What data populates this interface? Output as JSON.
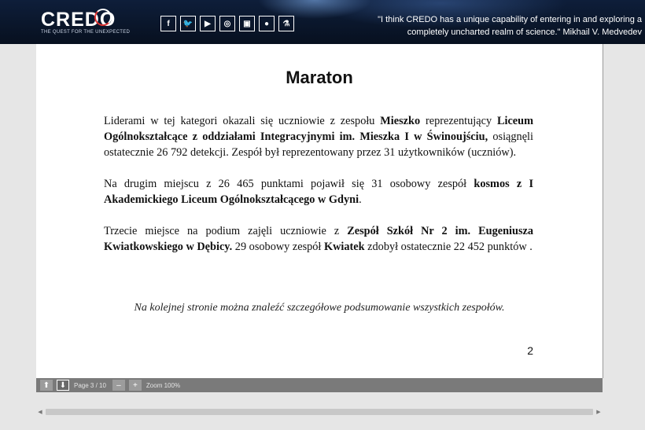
{
  "header": {
    "logo_text": "CREDO",
    "logo_tagline": "THE QUEST FOR THE UNEXPECTED",
    "quote_line1": "\"I think CREDO has a unique capability of entering in and exploring a",
    "quote_line2": "completely uncharted realm of science.\" Mikhail V. Medvedev",
    "socials": [
      {
        "icon": "facebook-icon",
        "glyph": "f"
      },
      {
        "icon": "twitter-icon",
        "glyph": "🐦"
      },
      {
        "icon": "youtube-icon",
        "glyph": "▶"
      },
      {
        "icon": "instagram-icon",
        "glyph": "◎"
      },
      {
        "icon": "camera-icon",
        "glyph": "▣"
      },
      {
        "icon": "github-icon",
        "glyph": "●"
      },
      {
        "icon": "flask-icon",
        "glyph": "⚗"
      }
    ]
  },
  "document": {
    "title": "Maraton",
    "p1": {
      "t1": "Liderami w tej kategori okazali się uczniowie z zespołu ",
      "b1": "Mieszko",
      "t2": " reprezentujący ",
      "b2": "Liceum Ogólnokształcące z oddziałami Integracyjnymi im. Mieszka I w Świnoujściu,",
      "t3": " osiągnęli ostatecznie 26 792 detekcji. Zespół był reprezentowany przez 31 użytkowników (uczniów)."
    },
    "p2": {
      "t1": "Na drugim miejscu z 26 465 punktami pojawił się 31 osobowy zespół ",
      "b1": "kosmos z I Akademickiego Liceum Ogólnokształcącego w Gdyni",
      "t2": "."
    },
    "p3": {
      "t1": "Trzecie miejsce na podium zajęli uczniowie z ",
      "b1": "Zespół Szkół Nr 2 im. Eugeniusza Kwiatkowskiego w Dębicy.",
      "t2": " 29 osobowy zespół ",
      "b2": "Kwiatek",
      "t3": " zdobył ostatecznie 22 452 punktów ."
    },
    "note": "Na kolejnej stronie można znaleźć szczegółowe podsumowanie wszystkich zespołów.",
    "page_number": "2"
  },
  "viewer": {
    "page_label": "Page 3 / 10",
    "zoom_label": "Zoom 100%",
    "up_glyph": "⬆",
    "down_glyph": "⬇",
    "minus_glyph": "–",
    "plus_glyph": "+",
    "scroll_left_glyph": "◀",
    "scroll_right_glyph": "▶"
  }
}
